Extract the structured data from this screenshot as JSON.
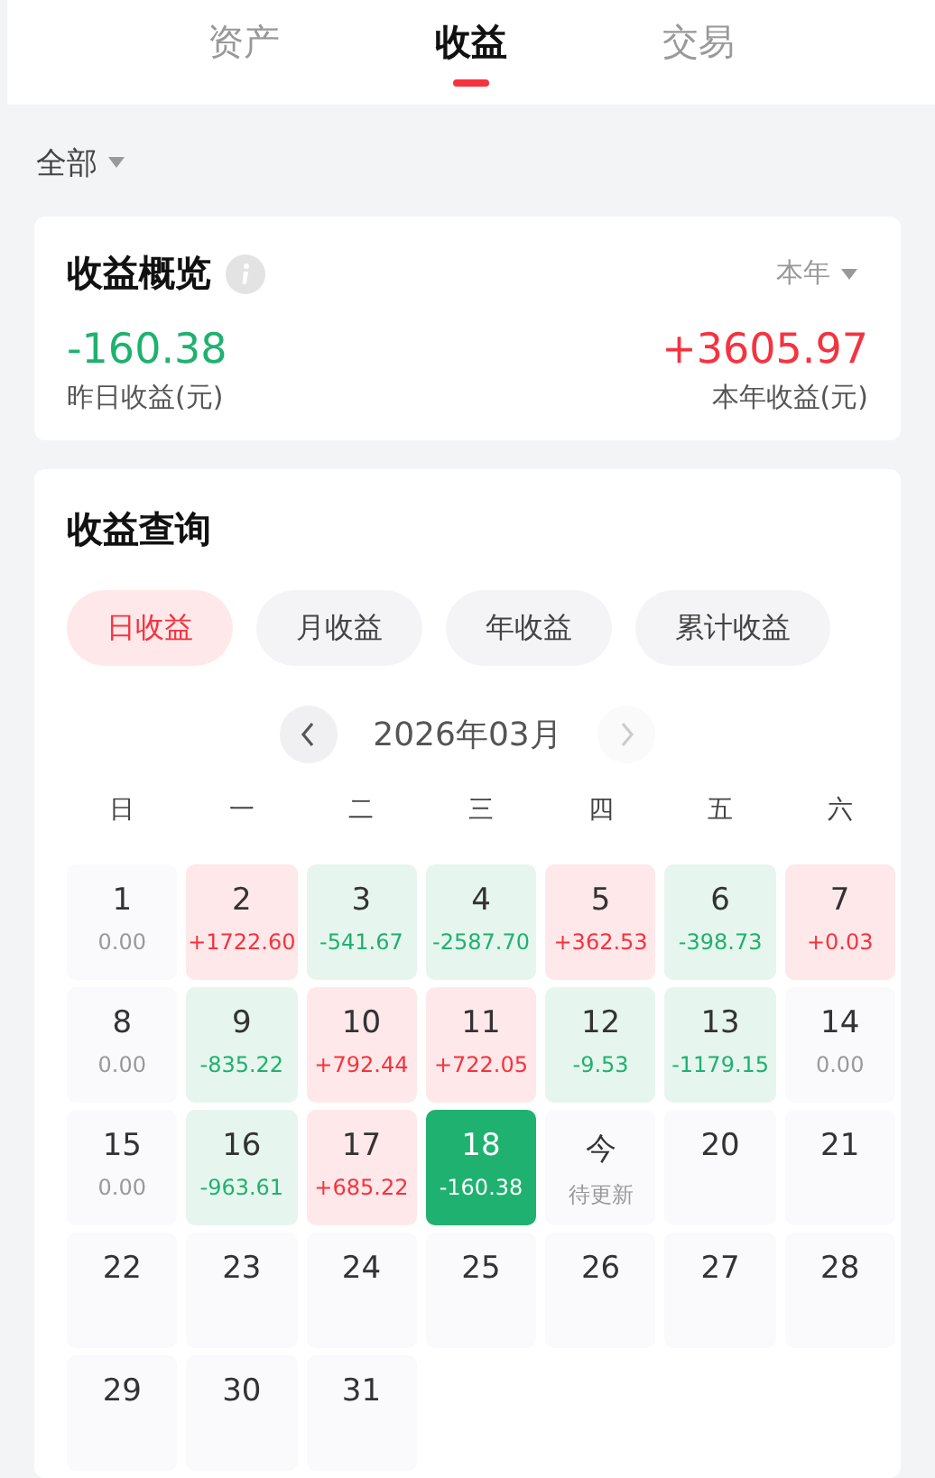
{
  "tabs": [
    {
      "label": "资产",
      "selected": false
    },
    {
      "label": "收益",
      "selected": true
    },
    {
      "label": "交易",
      "selected": false
    }
  ],
  "filter": {
    "label": "全部"
  },
  "overview": {
    "title": "收益概览",
    "period": "本年",
    "stats": [
      {
        "value": "-160.38",
        "label": "昨日收益(元)",
        "kind": "loss"
      },
      {
        "value": "+3605.97",
        "label": "本年收益(元)",
        "kind": "gain"
      }
    ]
  },
  "query": {
    "title": "收益查询",
    "chips": [
      {
        "label": "日收益",
        "selected": true
      },
      {
        "label": "月收益",
        "selected": false
      },
      {
        "label": "年收益",
        "selected": false
      },
      {
        "label": "累计收益",
        "selected": false
      }
    ],
    "month": "2026年03月",
    "weekdays": [
      "日",
      "一",
      "二",
      "三",
      "四",
      "五",
      "六"
    ],
    "days": [
      {
        "day": "1",
        "value": "0.00",
        "kind": "flat",
        "selected": false
      },
      {
        "day": "2",
        "value": "+1722.60",
        "kind": "gain",
        "selected": false
      },
      {
        "day": "3",
        "value": "-541.67",
        "kind": "loss",
        "selected": false
      },
      {
        "day": "4",
        "value": "-2587.70",
        "kind": "loss",
        "selected": false
      },
      {
        "day": "5",
        "value": "+362.53",
        "kind": "gain",
        "selected": false
      },
      {
        "day": "6",
        "value": "-398.73",
        "kind": "loss",
        "selected": false
      },
      {
        "day": "7",
        "value": "+0.03",
        "kind": "gain",
        "selected": false
      },
      {
        "day": "8",
        "value": "0.00",
        "kind": "flat",
        "selected": false
      },
      {
        "day": "9",
        "value": "-835.22",
        "kind": "loss",
        "selected": false
      },
      {
        "day": "10",
        "value": "+792.44",
        "kind": "gain",
        "selected": false
      },
      {
        "day": "11",
        "value": "+722.05",
        "kind": "gain",
        "selected": false
      },
      {
        "day": "12",
        "value": "-9.53",
        "kind": "loss",
        "selected": false
      },
      {
        "day": "13",
        "value": "-1179.15",
        "kind": "loss",
        "selected": false
      },
      {
        "day": "14",
        "value": "0.00",
        "kind": "flat",
        "selected": false
      },
      {
        "day": "15",
        "value": "0.00",
        "kind": "flat",
        "selected": false
      },
      {
        "day": "16",
        "value": "-963.61",
        "kind": "loss",
        "selected": false
      },
      {
        "day": "17",
        "value": "+685.22",
        "kind": "gain",
        "selected": false
      },
      {
        "day": "18",
        "value": "-160.38",
        "kind": "loss",
        "selected": true
      },
      {
        "day": "今",
        "value": "待更新",
        "kind": "pending",
        "selected": false
      },
      {
        "day": "20",
        "kind": "none",
        "selected": false
      },
      {
        "day": "21",
        "kind": "none",
        "selected": false
      },
      {
        "day": "22",
        "kind": "none",
        "selected": false
      },
      {
        "day": "23",
        "kind": "none",
        "selected": false
      },
      {
        "day": "24",
        "kind": "none",
        "selected": false
      },
      {
        "day": "25",
        "kind": "none",
        "selected": false
      },
      {
        "day": "26",
        "kind": "none",
        "selected": false
      },
      {
        "day": "27",
        "kind": "none",
        "selected": false
      },
      {
        "day": "28",
        "kind": "none",
        "selected": false
      },
      {
        "day": "29",
        "kind": "none",
        "selected": false
      },
      {
        "day": "30",
        "kind": "none",
        "selected": false
      },
      {
        "day": "31",
        "kind": "none",
        "selected": false
      }
    ]
  }
}
